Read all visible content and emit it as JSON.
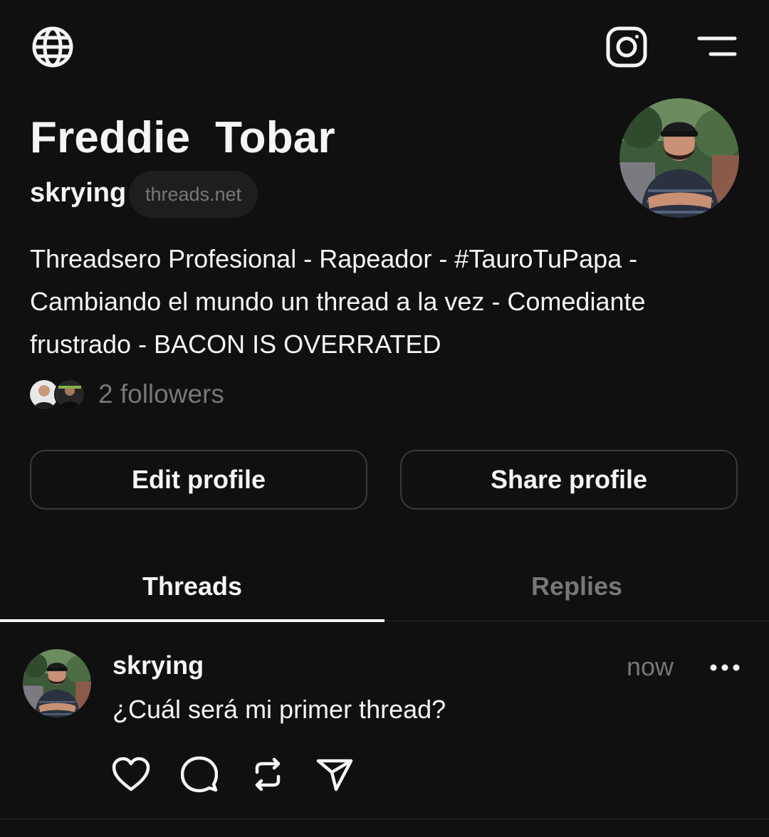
{
  "profile": {
    "name": "Freddie  Tobar",
    "username": "skrying",
    "domain": "threads.net",
    "bio": "Threadsero Profesional - Rapeador - #TauroTuPapa - Cambiando el mundo un thread a la vez -  Comediante frustrado - BACON IS OVERRATED",
    "followers_text": "2 followers"
  },
  "buttons": {
    "edit": "Edit profile",
    "share": "Share profile"
  },
  "tabs": [
    {
      "label": "Threads",
      "active": true
    },
    {
      "label": "Replies",
      "active": false
    }
  ],
  "post": {
    "username": "skrying",
    "time": "now",
    "text": "¿Cuál será mi primer thread?"
  },
  "icons": {
    "top_left": "globe-icon",
    "top_right_1": "instagram-icon",
    "top_right_2": "menu-icon",
    "actions": [
      "heart-icon",
      "comment-icon",
      "repost-icon",
      "send-icon"
    ],
    "more": "more-horizontal-icon"
  },
  "colors": {
    "background": "#101010",
    "text": "#f3f5f7",
    "muted": "#777777",
    "border": "#3a3a3a"
  }
}
